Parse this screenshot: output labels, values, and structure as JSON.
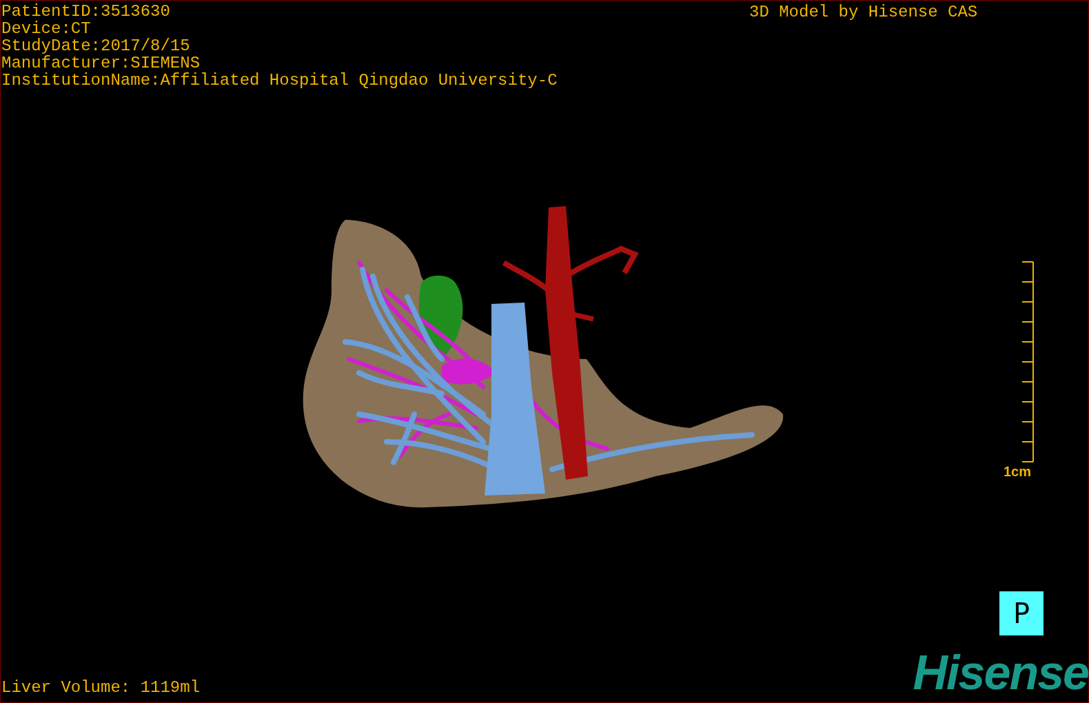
{
  "info_lines": [
    "PatientID:3513630",
    "Device:CT",
    "StudyDate:2017/8/15",
    "Manufacturer:SIEMENS",
    "InstitutionName:Affiliated Hospital Qingdao University-C"
  ],
  "title": "3D Model by Hisense CAS",
  "scale": {
    "label": "1cm"
  },
  "view_button": {
    "label": "P"
  },
  "logo": "Hisense",
  "liver_volume": "Liver Volume: 1119ml"
}
